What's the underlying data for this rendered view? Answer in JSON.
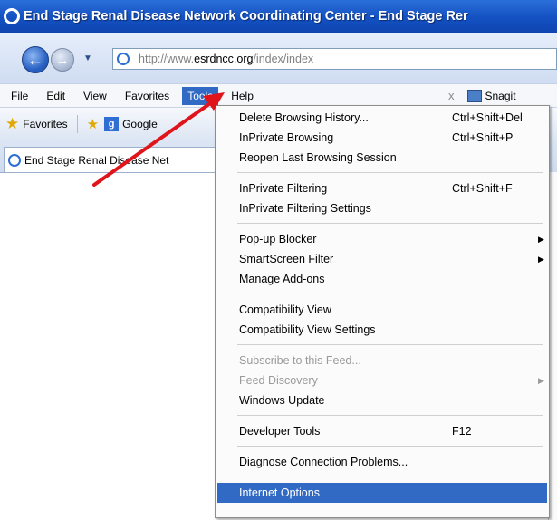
{
  "window": {
    "title": "End Stage Renal Disease Network Coordinating Center - End Stage Rer"
  },
  "address": {
    "url_prefix": "http://www.",
    "url_domain": "esrdncc.org",
    "url_path": "/index/index"
  },
  "menubar": {
    "items": [
      "File",
      "Edit",
      "View",
      "Favorites",
      "Tools",
      "Help"
    ],
    "close_label": "x",
    "snagit_label": "Snagit"
  },
  "favbar": {
    "favorites_label": "Favorites",
    "google_label": "Google"
  },
  "tab": {
    "label": "End Stage Renal Disease Net"
  },
  "tools_menu": {
    "groups": [
      [
        {
          "label": "Delete Browsing History...",
          "shortcut": "Ctrl+Shift+Del"
        },
        {
          "label": "InPrivate Browsing",
          "shortcut": "Ctrl+Shift+P"
        },
        {
          "label": "Reopen Last Browsing Session",
          "shortcut": ""
        }
      ],
      [
        {
          "label": "InPrivate Filtering",
          "shortcut": "Ctrl+Shift+F"
        },
        {
          "label": "InPrivate Filtering Settings",
          "shortcut": ""
        }
      ],
      [
        {
          "label": "Pop-up Blocker",
          "shortcut": "",
          "submenu": true
        },
        {
          "label": "SmartScreen Filter",
          "shortcut": "",
          "submenu": true
        },
        {
          "label": "Manage Add-ons",
          "shortcut": ""
        }
      ],
      [
        {
          "label": "Compatibility View",
          "shortcut": ""
        },
        {
          "label": "Compatibility View Settings",
          "shortcut": ""
        }
      ],
      [
        {
          "label": "Subscribe to this Feed...",
          "shortcut": "",
          "disabled": true
        },
        {
          "label": "Feed Discovery",
          "shortcut": "",
          "disabled": true,
          "submenu": true
        },
        {
          "label": "Windows Update",
          "shortcut": ""
        }
      ],
      [
        {
          "label": "Developer Tools",
          "shortcut": "F12"
        }
      ],
      [
        {
          "label": "Diagnose Connection Problems...",
          "shortcut": ""
        }
      ],
      [
        {
          "label": "Internet Options",
          "shortcut": "",
          "selected": true
        }
      ]
    ]
  },
  "colors": {
    "highlight": "#316ac5",
    "annotation_arrow": "#e0141b",
    "title_bar": "#1451c2"
  }
}
